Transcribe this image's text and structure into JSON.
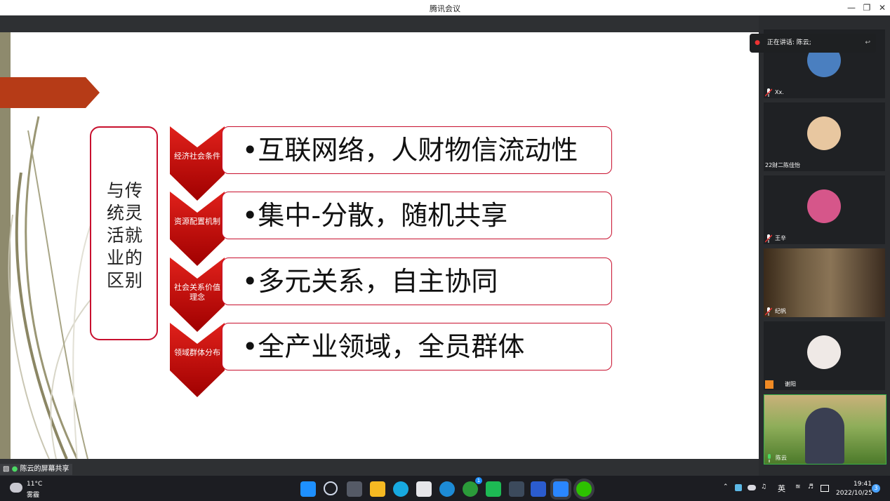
{
  "window": {
    "title": "腾讯会议"
  },
  "slide": {
    "label": "与传统灵活就业的区别",
    "rows": [
      {
        "chevron": "经济社会条件",
        "text": "•互联网络，人财物信流动性"
      },
      {
        "chevron": "资源配置机制",
        "text": "•集中-分散，随机共享"
      },
      {
        "chevron": "社会关系价值理念",
        "text": "•多元关系，自主协同"
      },
      {
        "chevron": "领域群体分布",
        "text": "•全产业领域，全员群体"
      }
    ],
    "colors": {
      "accent": "#c8102e",
      "chevron_top": "#e0211b",
      "chevron_bottom": "#a00000",
      "banner": "#b63b17"
    }
  },
  "share_status": "陈云的屏幕共享",
  "speaking": "正在讲话: 陈云;",
  "participants": [
    {
      "name": "Xx.",
      "avatar_color": "#4a7fc0"
    },
    {
      "name": "22财二陈佳怡",
      "avatar_color": "#e8c7a0"
    },
    {
      "name": "王辛",
      "avatar_color": "#d6568a"
    },
    {
      "name": "纪帆",
      "avatar_color": "#7a5a3a"
    },
    {
      "name": "谢阳",
      "avatar_color": "#efe9e6"
    },
    {
      "name": "陈云",
      "avatar_color": "#6e9a3c"
    }
  ],
  "taskbar": {
    "weather_temp": "11°C",
    "weather_desc": "雾霾",
    "ime": "英",
    "time": "19:41",
    "date": "2022/10/25",
    "notifications": "3",
    "badge": "1"
  }
}
